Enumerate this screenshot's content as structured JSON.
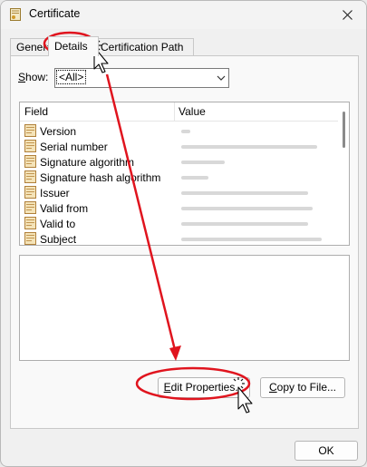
{
  "window": {
    "title": "Certificate"
  },
  "tabs": [
    {
      "label": "General",
      "active": false
    },
    {
      "label": "Details",
      "active": true
    },
    {
      "label": "Certification Path",
      "active": false
    }
  ],
  "show": {
    "label_prefix": "",
    "label_accel": "S",
    "label_rest": "how:",
    "selected": "<All>"
  },
  "list": {
    "headers": {
      "field": "Field",
      "value": "Value"
    },
    "rows": [
      {
        "field": "Version"
      },
      {
        "field": "Serial number"
      },
      {
        "field": "Signature algorithm"
      },
      {
        "field": "Signature hash algorithm"
      },
      {
        "field": "Issuer"
      },
      {
        "field": "Valid from"
      },
      {
        "field": "Valid to"
      },
      {
        "field": "Subject"
      }
    ]
  },
  "buttons": {
    "edit_accel": "E",
    "edit_rest": "dit Properties...",
    "copy_accel": "C",
    "copy_rest": "opy to File...",
    "ok": "OK"
  },
  "colors": {
    "annotation": "#e0141e",
    "value_blur": "#d8d8d8"
  }
}
